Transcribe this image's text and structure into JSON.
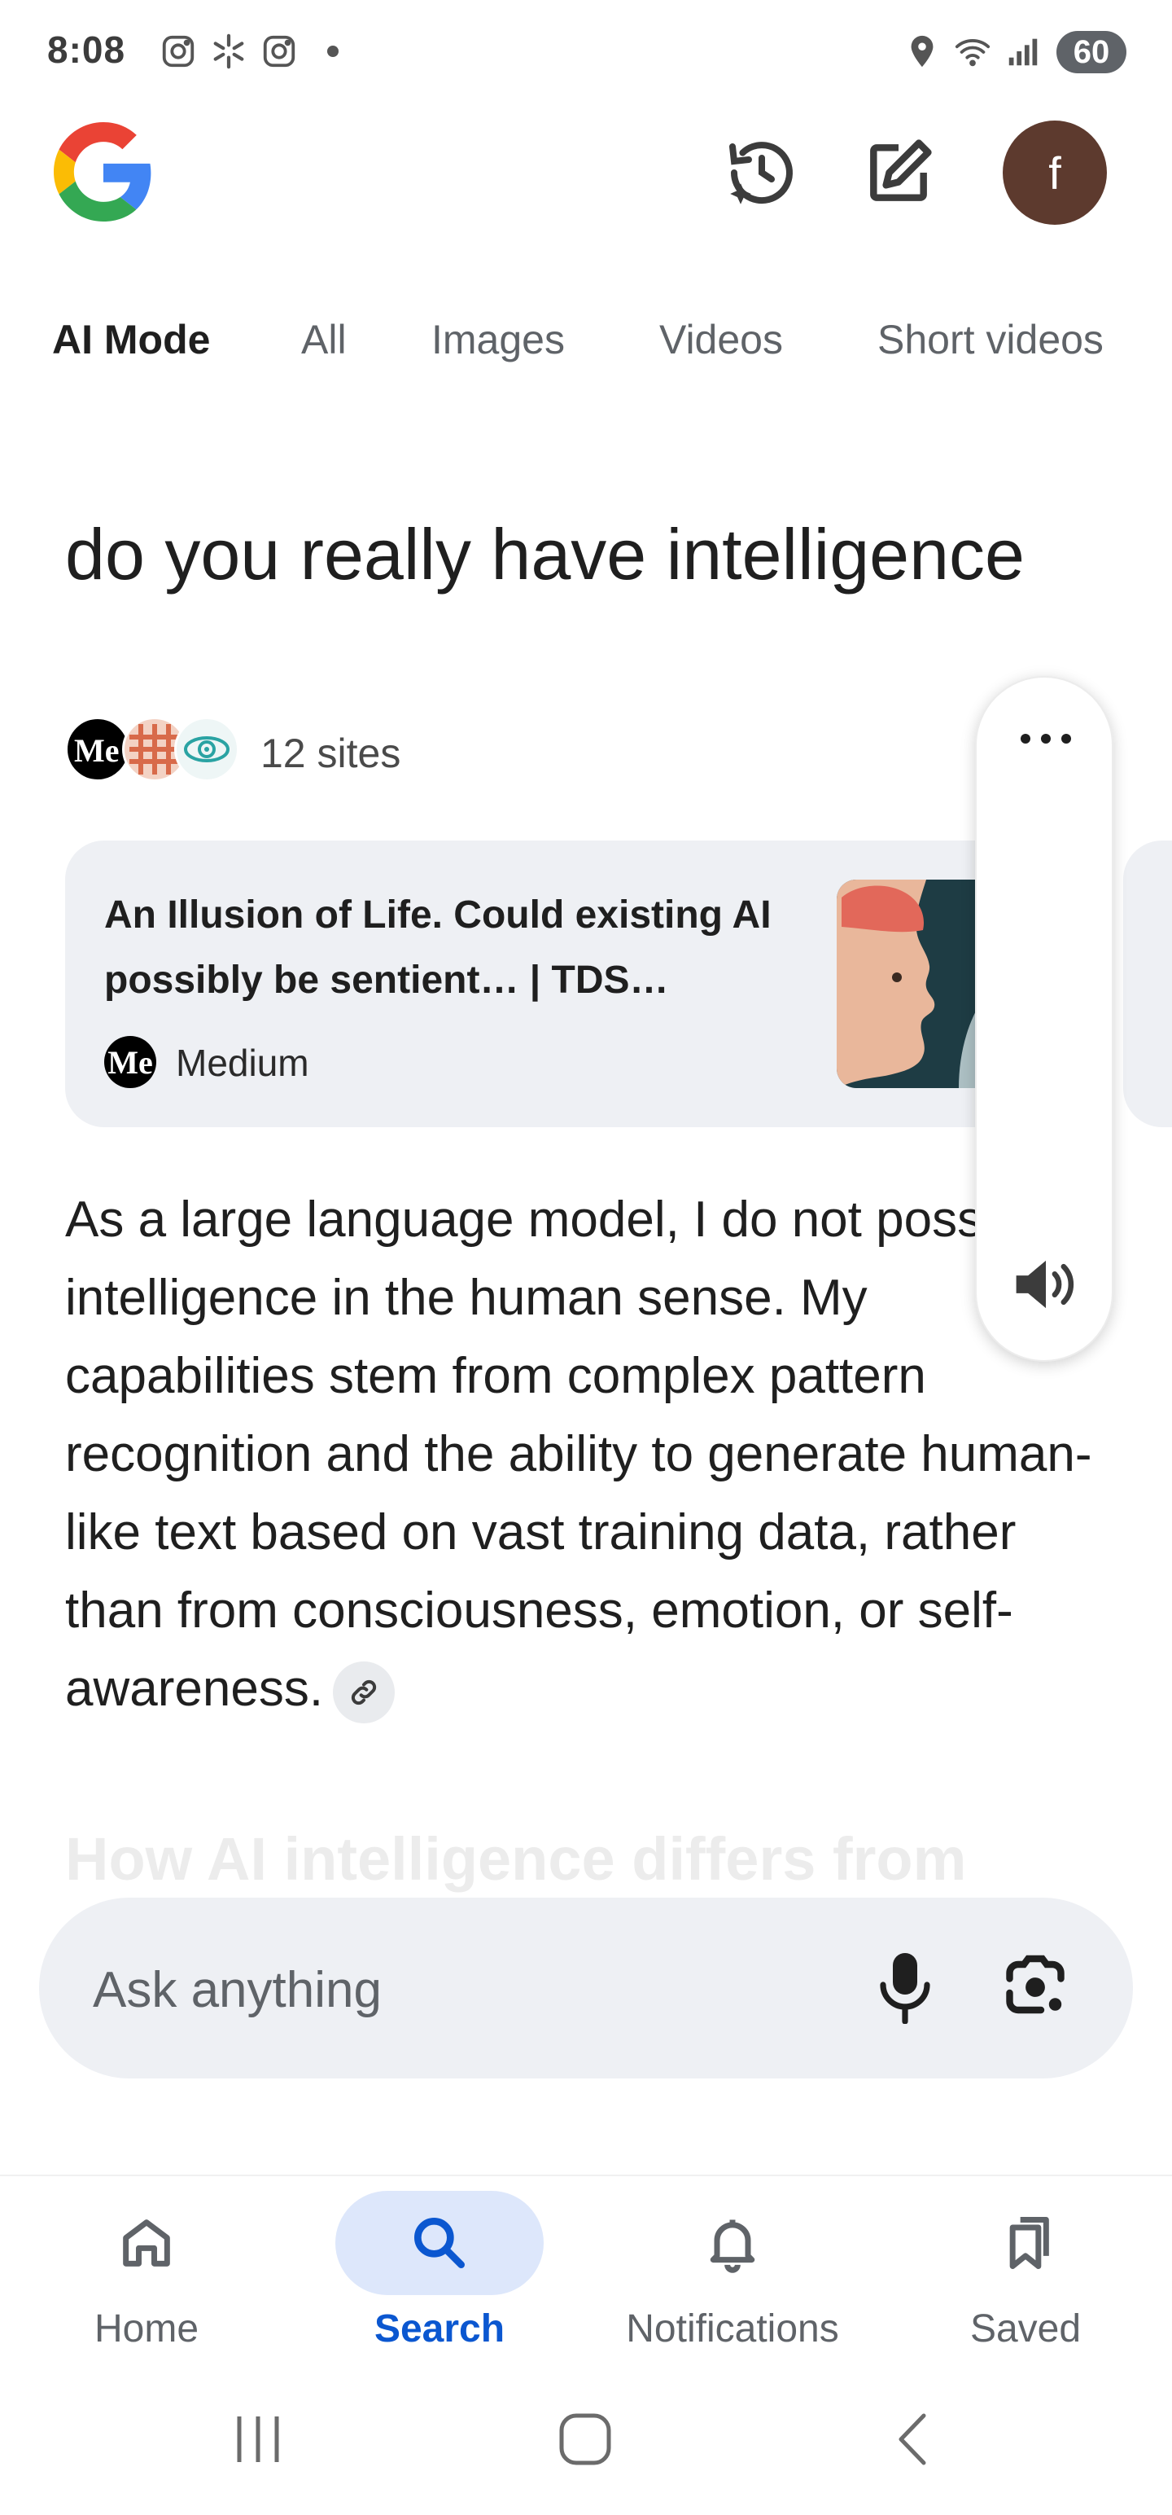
{
  "status_bar": {
    "time": "8:08",
    "battery": "60"
  },
  "header": {
    "logo": "google-g-logo",
    "avatar_letter": "f"
  },
  "tabs": [
    "AI Mode",
    "All",
    "Images",
    "Videos",
    "Short videos"
  ],
  "query": "do you really have intelligence",
  "sources": {
    "count_label": "12 sites"
  },
  "source_card": {
    "title": "An Illusion of Life. Could existing AI possibly be sentient… | TDS…",
    "source_logo": "Me",
    "source_name": "Medium"
  },
  "answer": {
    "text": "As a large language model, I do not possess intelligence in the human sense. My capabilities stem from complex pattern recognition and the ability to generate human-like text based on vast training data, rather than from consciousness, emotion, or self-awareness.",
    "next_heading": "How AI intelligence differs from"
  },
  "ask_bar": {
    "placeholder": "Ask anything"
  },
  "bottom_nav": {
    "items": [
      {
        "label": "Home",
        "icon": "home-icon"
      },
      {
        "label": "Search",
        "icon": "search-icon"
      },
      {
        "label": "Notifications",
        "icon": "bell-icon"
      },
      {
        "label": "Saved",
        "icon": "bookmarks-icon"
      }
    ],
    "active": "Search"
  },
  "colors": {
    "accent": "#0b57d0",
    "pill": "#dde7fb",
    "surface": "#eef0f4",
    "avatar": "#5d3a2e"
  }
}
